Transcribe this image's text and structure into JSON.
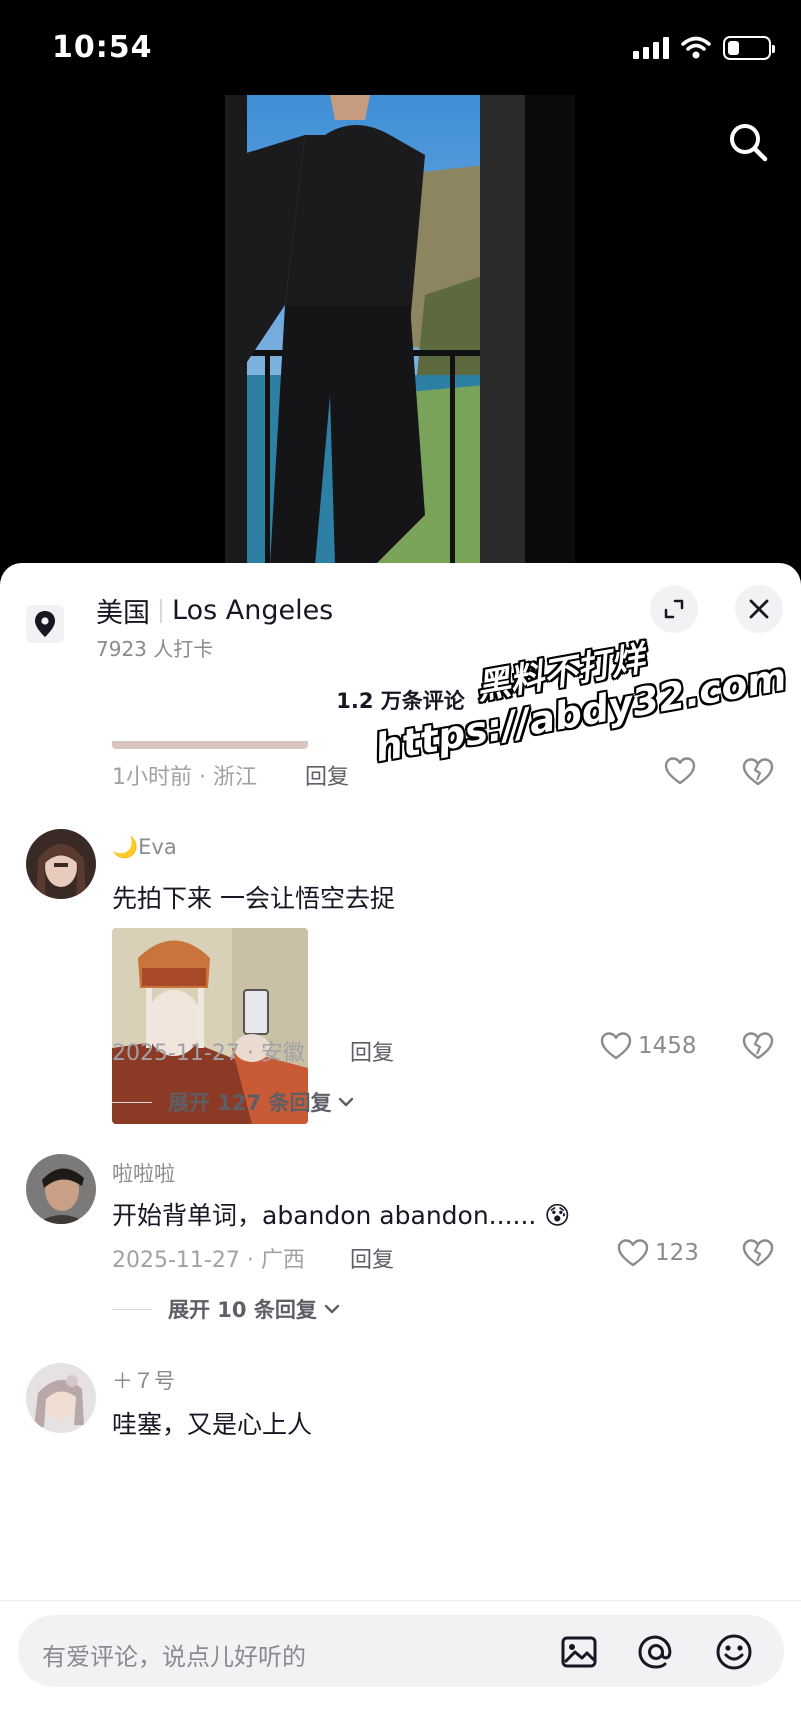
{
  "status_bar": {
    "time": "10:54"
  },
  "location": {
    "country": "美国",
    "city": "Los Angeles",
    "checkins": "7923 人打卡"
  },
  "comments_header": {
    "total": "1.2 万条评论"
  },
  "comments": [
    {
      "time_location": "1小时前 · 浙江",
      "reply_label": "回复",
      "likes": ""
    },
    {
      "username": "🌙Eva",
      "text": "先拍下来 一会让悟空去捉",
      "time_location": "2025-11-27 · 安徽",
      "reply_label": "回复",
      "likes": "1458",
      "expand_replies": "展开 127 条回复"
    },
    {
      "username": "啦啦啦",
      "text": "开始背单词，abandon abandon...... 😰",
      "time_location": "2025-11-27 · 广西",
      "reply_label": "回复",
      "likes": "123",
      "expand_replies": "展开 10 条回复"
    },
    {
      "username": "＋７号",
      "text": "哇塞，又是心上人"
    }
  ],
  "input_bar": {
    "placeholder": "有爱评论，说点儿好听的"
  },
  "watermark": {
    "line1": "黑料不打烊",
    "line2": "https://abdy32.com"
  },
  "icons": [
    "search-icon",
    "location-pin-icon",
    "expand-icon",
    "close-icon",
    "heart-icon",
    "broken-heart-icon",
    "chevron-down-icon",
    "image-icon",
    "at-icon",
    "emoji-icon"
  ],
  "colors": {
    "text": "#161823",
    "secondary": "#8a8b91",
    "sheet": "#ffffff",
    "background": "#000000"
  }
}
